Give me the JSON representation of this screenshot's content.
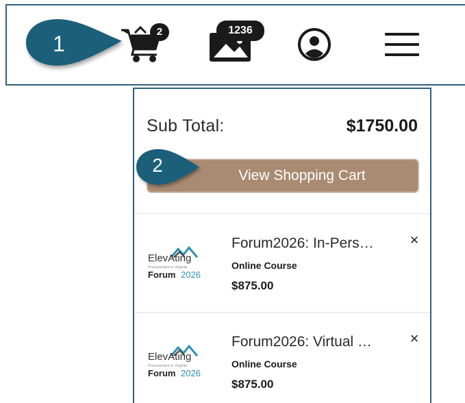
{
  "header": {
    "cart_badge": "2",
    "messages_badge": "1236",
    "icons": {
      "cart": "shopping-cart-icon",
      "messages": "messages-icon",
      "account": "user-account-icon",
      "menu": "hamburger-menu-icon"
    }
  },
  "callouts": {
    "step1": "1",
    "step2": "2"
  },
  "cart": {
    "subtotal_label": "Sub Total:",
    "subtotal_value": "$1750.00",
    "view_cart_label": "View Shopping Cart",
    "remove_symbol": "×",
    "items": [
      {
        "title": "Forum2026: In-Pers…",
        "type": "Online Course",
        "price": "$875.00",
        "logo": {
          "line1": "ElevAting",
          "line2": "Procurement in Virginia",
          "line3a": "Forum",
          "line3b": "2026"
        }
      },
      {
        "title": "Forum2026: Virtual …",
        "type": "Online Course",
        "price": "$875.00",
        "logo": {
          "line1": "ElevAting",
          "line2": "Procurement in Virginia",
          "line3a": "Forum",
          "line3b": "2026"
        }
      }
    ]
  },
  "colors": {
    "border": "#2d5f7e",
    "callout": "#1f5f7a",
    "button": "#a98a72",
    "badge": "#1a1a1a"
  }
}
